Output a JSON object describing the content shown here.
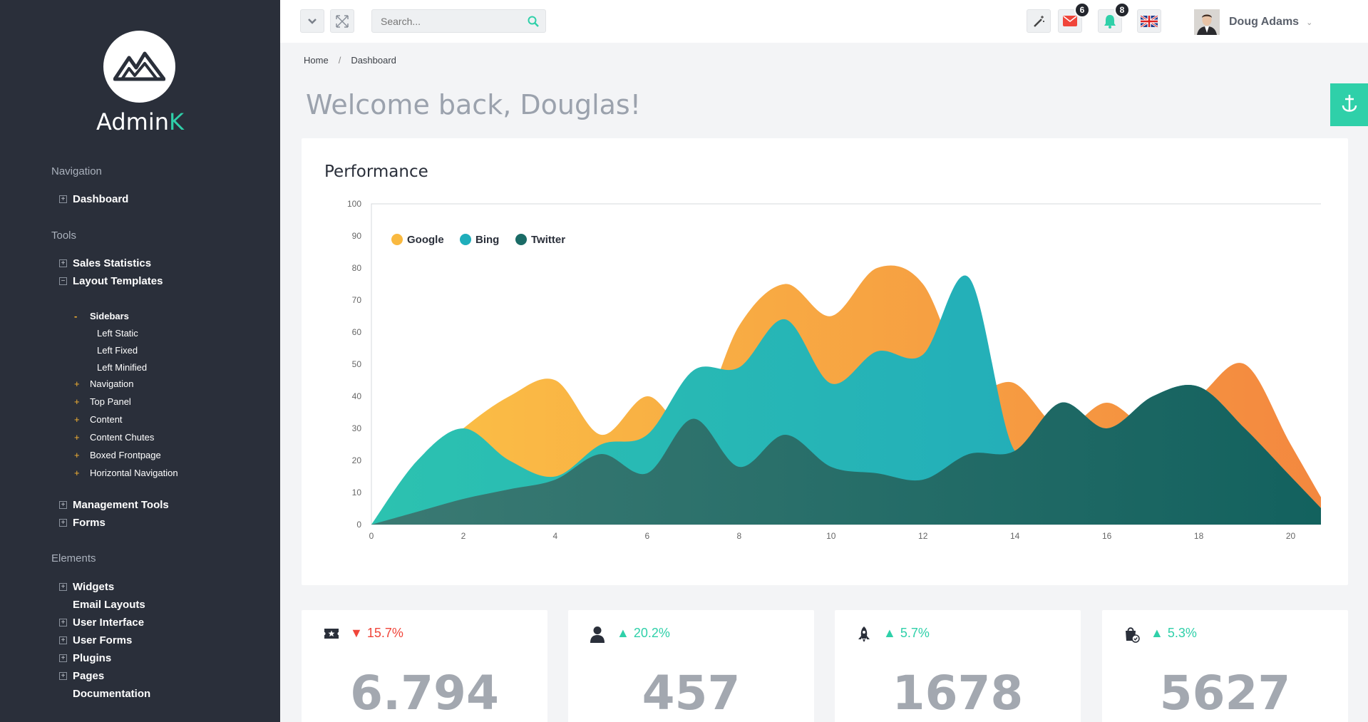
{
  "brand": {
    "name_main": "Admin",
    "name_accent": "K"
  },
  "sidebar": {
    "sections": {
      "navigation": "Navigation",
      "tools": "Tools",
      "elements": "Elements"
    },
    "dashboard": "Dashboard",
    "sales_statistics": "Sales Statistics",
    "layout_templates": "Layout Templates",
    "sidebars": "Sidebars",
    "left_static": "Left Static",
    "left_fixed": "Left Fixed",
    "left_minified": "Left Minified",
    "navigation": "Navigation",
    "top_panel": "Top Panel",
    "content": "Content",
    "content_chutes": "Content Chutes",
    "boxed_frontpage": "Boxed Frontpage",
    "horizontal_navigation": "Horizontal Navigation",
    "management_tools": "Management Tools",
    "forms": "Forms",
    "widgets": "Widgets",
    "email_layouts": "Email Layouts",
    "user_interface": "User Interface",
    "user_forms": "User Forms",
    "plugins": "Plugins",
    "pages": "Pages",
    "documentation": "Documentation"
  },
  "topbar": {
    "search_placeholder": "Search...",
    "mail_count": "6",
    "notif_count": "8",
    "user_name": "Doug Adams"
  },
  "breadcrumb": {
    "home": "Home",
    "sep": "/",
    "current": "Dashboard"
  },
  "page_title": "Welcome back, Douglas!",
  "card_title": "Performance",
  "chart_data": {
    "type": "area",
    "x": [
      0,
      1,
      2,
      3,
      4,
      5,
      6,
      7,
      8,
      9,
      10,
      11,
      12,
      13,
      14,
      15,
      16,
      17,
      18,
      19,
      20,
      21
    ],
    "xticks": [
      0,
      2,
      4,
      6,
      8,
      10,
      12,
      14,
      16,
      18,
      20
    ],
    "yticks": [
      0,
      10,
      20,
      30,
      40,
      50,
      60,
      70,
      80,
      90,
      100
    ],
    "ylim": [
      0,
      100
    ],
    "xlim": [
      0,
      21
    ],
    "legend_position": "top-left",
    "series": [
      {
        "name": "Google",
        "color": "#f9b940",
        "values": [
          0,
          17,
          30,
          40,
          45,
          28,
          40,
          30,
          62,
          75,
          65,
          80,
          75,
          44,
          44,
          30,
          38,
          30,
          40,
          50,
          25,
          0
        ]
      },
      {
        "name": "Bing",
        "color": "#1faebb",
        "values": [
          0,
          20,
          30,
          20,
          15,
          25,
          28,
          48,
          49,
          64,
          44,
          54,
          53,
          77,
          23,
          38,
          30,
          40,
          43,
          30,
          15,
          0
        ]
      },
      {
        "name": "Twitter",
        "color": "#1a6b66",
        "values": [
          0,
          4,
          8,
          11,
          14,
          22,
          16,
          33,
          18,
          28,
          18,
          16,
          14,
          22,
          23,
          38,
          30,
          40,
          43,
          30,
          15,
          0
        ]
      }
    ]
  },
  "stats": [
    {
      "delta": "15.7%",
      "value": "6.794"
    },
    {
      "delta": "20.2%",
      "value": "457"
    },
    {
      "delta": "5.7%",
      "value": "1678"
    },
    {
      "delta": "5.3%",
      "value": "5627"
    }
  ],
  "colors": {
    "accent": "#2fd0a9",
    "down": "#f0453a",
    "sidebar": "#2a2f3a"
  },
  "icons": {
    "logo": "mountain-logo-icon",
    "stat1": "ticket-icon",
    "stat2": "user-icon",
    "stat3": "rocket-icon",
    "stat4": "shopping-bag-icon"
  }
}
